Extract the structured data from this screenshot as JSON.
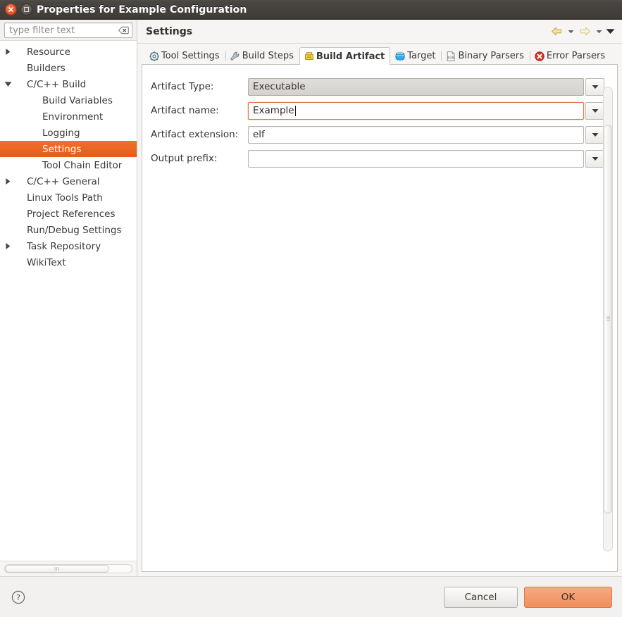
{
  "window": {
    "title": "Properties for Example Configuration",
    "close_icon": "close-x-icon",
    "restore_icon": "restore-window-icon"
  },
  "sidebar": {
    "filter": {
      "placeholder": "type filter text",
      "value": "",
      "clear_icon": "clear-text-icon"
    },
    "items": [
      {
        "label": "Resource",
        "level": 0,
        "twisty": "collapsed",
        "selected": false
      },
      {
        "label": "Builders",
        "level": 0,
        "twisty": "none",
        "selected": false
      },
      {
        "label": "C/C++ Build",
        "level": 0,
        "twisty": "expanded",
        "selected": false
      },
      {
        "label": "Build Variables",
        "level": 1,
        "twisty": "none",
        "selected": false
      },
      {
        "label": "Environment",
        "level": 1,
        "twisty": "none",
        "selected": false
      },
      {
        "label": "Logging",
        "level": 1,
        "twisty": "none",
        "selected": false
      },
      {
        "label": "Settings",
        "level": 1,
        "twisty": "none",
        "selected": true
      },
      {
        "label": "Tool Chain Editor",
        "level": 1,
        "twisty": "none",
        "selected": false
      },
      {
        "label": "C/C++ General",
        "level": 0,
        "twisty": "collapsed",
        "selected": false
      },
      {
        "label": "Linux Tools Path",
        "level": 0,
        "twisty": "none",
        "selected": false
      },
      {
        "label": "Project References",
        "level": 0,
        "twisty": "none",
        "selected": false
      },
      {
        "label": "Run/Debug Settings",
        "level": 0,
        "twisty": "none",
        "selected": false
      },
      {
        "label": "Task Repository",
        "level": 0,
        "twisty": "collapsed",
        "selected": false
      },
      {
        "label": "WikiText",
        "level": 0,
        "twisty": "none",
        "selected": false
      }
    ],
    "selection_color": "#e35c19",
    "hscrollbar": {
      "thumb_fraction": 0.82
    }
  },
  "page": {
    "title": "Settings",
    "nav": {
      "back_icon": "back-arrow-icon",
      "back_menu_icon": "chevron-down-icon",
      "forward_icon": "forward-arrow-icon",
      "forward_menu_icon": "chevron-down-icon",
      "view_menu_icon": "view-menu-chevron-icon"
    }
  },
  "tabs": [
    {
      "label": "Tool Settings",
      "icon": "gear-icon",
      "active": false
    },
    {
      "label": "Build Steps",
      "icon": "wrench-icon",
      "active": false
    },
    {
      "label": "Build Artifact",
      "icon": "build-artifact-icon",
      "active": true
    },
    {
      "label": "Target",
      "icon": "globe-icon",
      "active": false
    },
    {
      "label": "Binary Parsers",
      "icon": "binary-file-icon",
      "active": false
    },
    {
      "label": "Error Parsers",
      "icon": "error-circle-icon",
      "active": false
    }
  ],
  "form": {
    "fields": [
      {
        "label": "Artifact Type:",
        "value": "Executable",
        "readonly": true,
        "focused": false,
        "dropdown_icon": "chevron-down-icon"
      },
      {
        "label": "Artifact name:",
        "value": "Example",
        "readonly": false,
        "focused": true,
        "dropdown_icon": "chevron-down-icon"
      },
      {
        "label": "Artifact extension:",
        "value": "elf",
        "readonly": false,
        "focused": false,
        "dropdown_icon": "chevron-down-icon"
      },
      {
        "label": "Output prefix:",
        "value": "",
        "readonly": false,
        "focused": false,
        "dropdown_icon": "chevron-down-icon"
      }
    ]
  },
  "footer": {
    "help_icon": "help-question-icon",
    "cancel_label": "Cancel",
    "ok_label": "OK",
    "ok_color": "#ef8f5f"
  },
  "scrollbar": {
    "vertical_thumb_fraction": 0.84
  }
}
